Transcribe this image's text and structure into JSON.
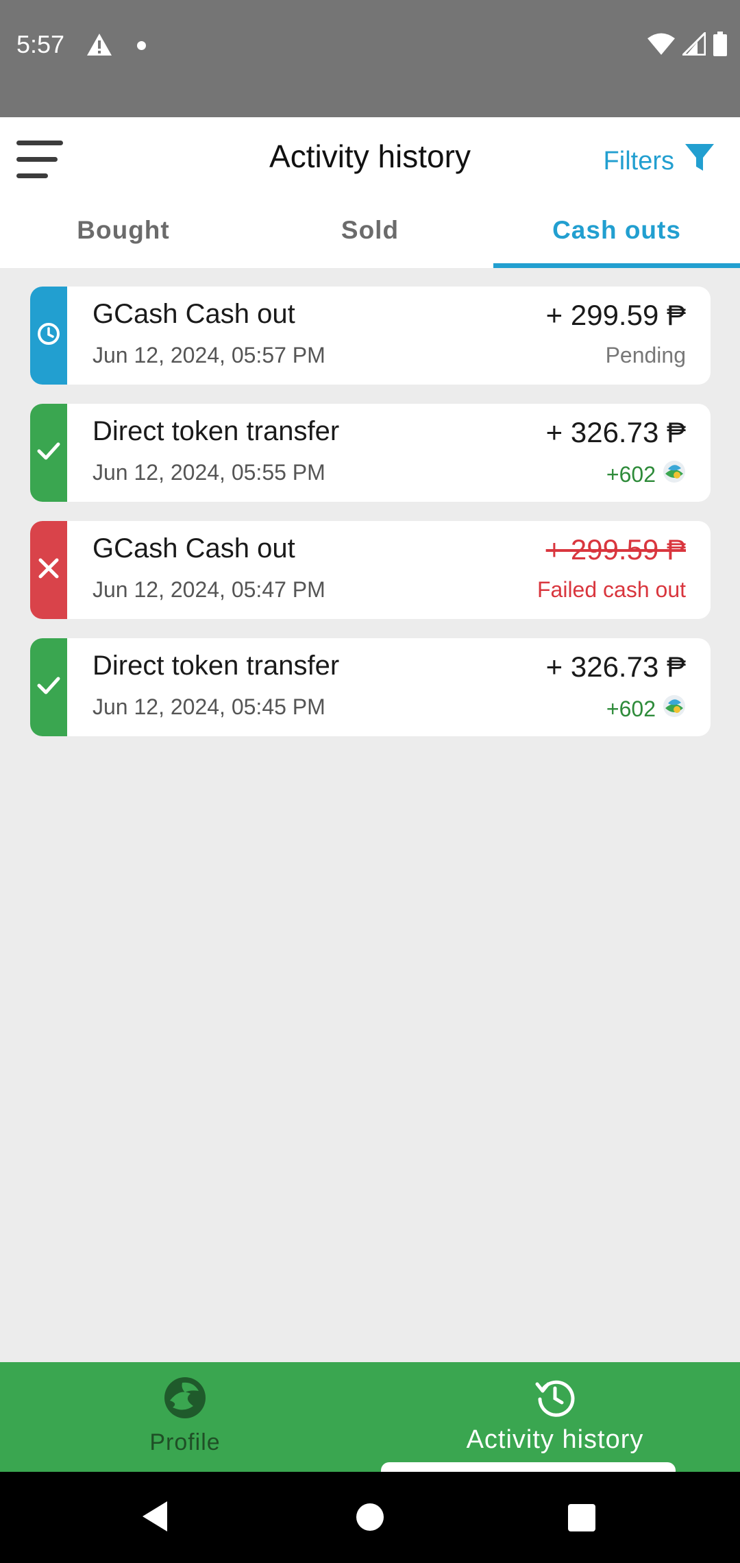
{
  "status_bar": {
    "time": "5:57",
    "left_icons": [
      "warning-icon",
      "notification-dot-icon"
    ],
    "right_icons": [
      "wifi-icon",
      "signal-icon",
      "battery-icon"
    ]
  },
  "header": {
    "title": "Activity history",
    "filters_label": "Filters",
    "menu_icon": "menu-icon",
    "filter_icon": "funnel-icon"
  },
  "tabs": [
    {
      "label": "Bought",
      "active": false
    },
    {
      "label": "Sold",
      "active": false
    },
    {
      "label": "Cash outs",
      "active": true
    }
  ],
  "transactions": [
    {
      "title": "GCash Cash out",
      "date": "Jun 12, 2024, 05:57 PM",
      "amount": "+ 299.59 ₱",
      "status_text": "Pending",
      "status": "pending",
      "status_icon": "clock-icon",
      "color": "#229fd0"
    },
    {
      "title": "Direct token transfer",
      "date": "Jun 12, 2024, 05:55 PM",
      "amount": "+ 326.73 ₱",
      "status_text": "+602",
      "status": "success",
      "status_icon": "check-icon",
      "color": "#3aa650",
      "token_icon": "token-coin-icon"
    },
    {
      "title": "GCash Cash out",
      "date": "Jun 12, 2024, 05:47 PM",
      "amount": "+ 299.59 ₱",
      "status_text": "Failed cash out",
      "status": "failed",
      "status_icon": "x-icon",
      "color": "#d9434a"
    },
    {
      "title": "Direct token transfer",
      "date": "Jun 12, 2024, 05:45 PM",
      "amount": "+ 326.73 ₱",
      "status_text": "+602",
      "status": "success",
      "status_icon": "check-icon",
      "color": "#3aa650",
      "token_icon": "token-coin-icon"
    }
  ],
  "bottom_nav": [
    {
      "label": "Profile",
      "icon": "profile-logo-icon",
      "active": false
    },
    {
      "label": "Activity history",
      "icon": "history-icon",
      "active": true
    }
  ],
  "colors": {
    "accent": "#229fd0",
    "success": "#3aa650",
    "failed": "#d9434a",
    "bonus": "#2e8b3a"
  }
}
